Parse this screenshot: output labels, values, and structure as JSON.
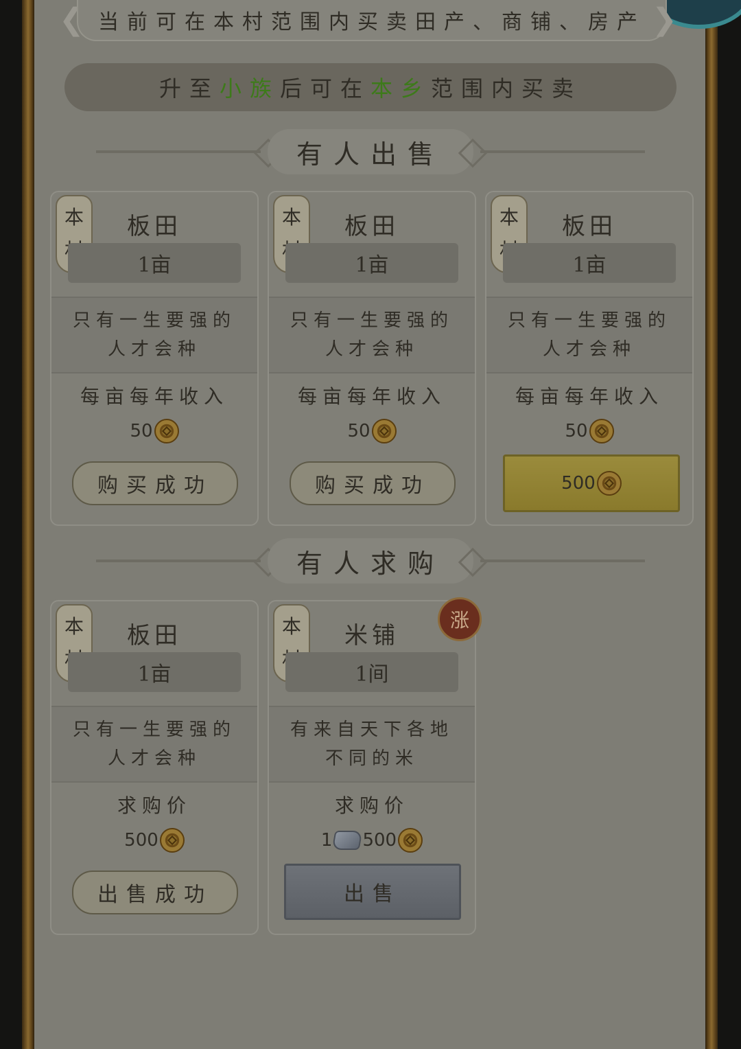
{
  "header": {
    "notice": "当前可在本村范围内买卖田产、商铺、房产"
  },
  "info_bar": {
    "prefix": "升至",
    "rank": "小族",
    "middle": "后可在",
    "scope": "本乡",
    "suffix": "范围内买卖"
  },
  "sections": {
    "selling_title": "有人出售",
    "buying_title": "有人求购"
  },
  "selling_cards": [
    {
      "badge_top": "本",
      "badge_bottom": "村",
      "name": "板田",
      "size": "1亩",
      "desc": "只有一生要强的人才会种",
      "price_label": "每亩每年收入",
      "price_value": "50",
      "button": "购买成功"
    },
    {
      "badge_top": "本",
      "badge_bottom": "村",
      "name": "板田",
      "size": "1亩",
      "desc": "只有一生要强的人才会种",
      "price_label": "每亩每年收入",
      "price_value": "50",
      "button": "购买成功"
    },
    {
      "badge_top": "本",
      "badge_bottom": "村",
      "name": "板田",
      "size": "1亩",
      "desc": "只有一生要强的人才会种",
      "price_label": "每亩每年收入",
      "price_value": "50",
      "button_price": "500"
    }
  ],
  "buying_cards": [
    {
      "badge_top": "本",
      "badge_bottom": "村",
      "name": "板田",
      "size": "1亩",
      "desc": "只有一生要强的人才会种",
      "price_label": "求购价",
      "price_value": "500",
      "button": "出售成功"
    },
    {
      "badge_top": "本",
      "badge_bottom": "村",
      "name": "米铺",
      "size": "1间",
      "desc": "有来自天下各地不同的米",
      "price_label": "求购价",
      "silver_value": "1",
      "price_value": "500",
      "button": "出售",
      "rise_badge": "涨"
    }
  ],
  "icons": {
    "currency": "copper-coin-icon",
    "silver": "silver-ingot-icon"
  },
  "colors": {
    "highlight_green": "#3d7a1a",
    "overlay": "#7e7d75"
  }
}
